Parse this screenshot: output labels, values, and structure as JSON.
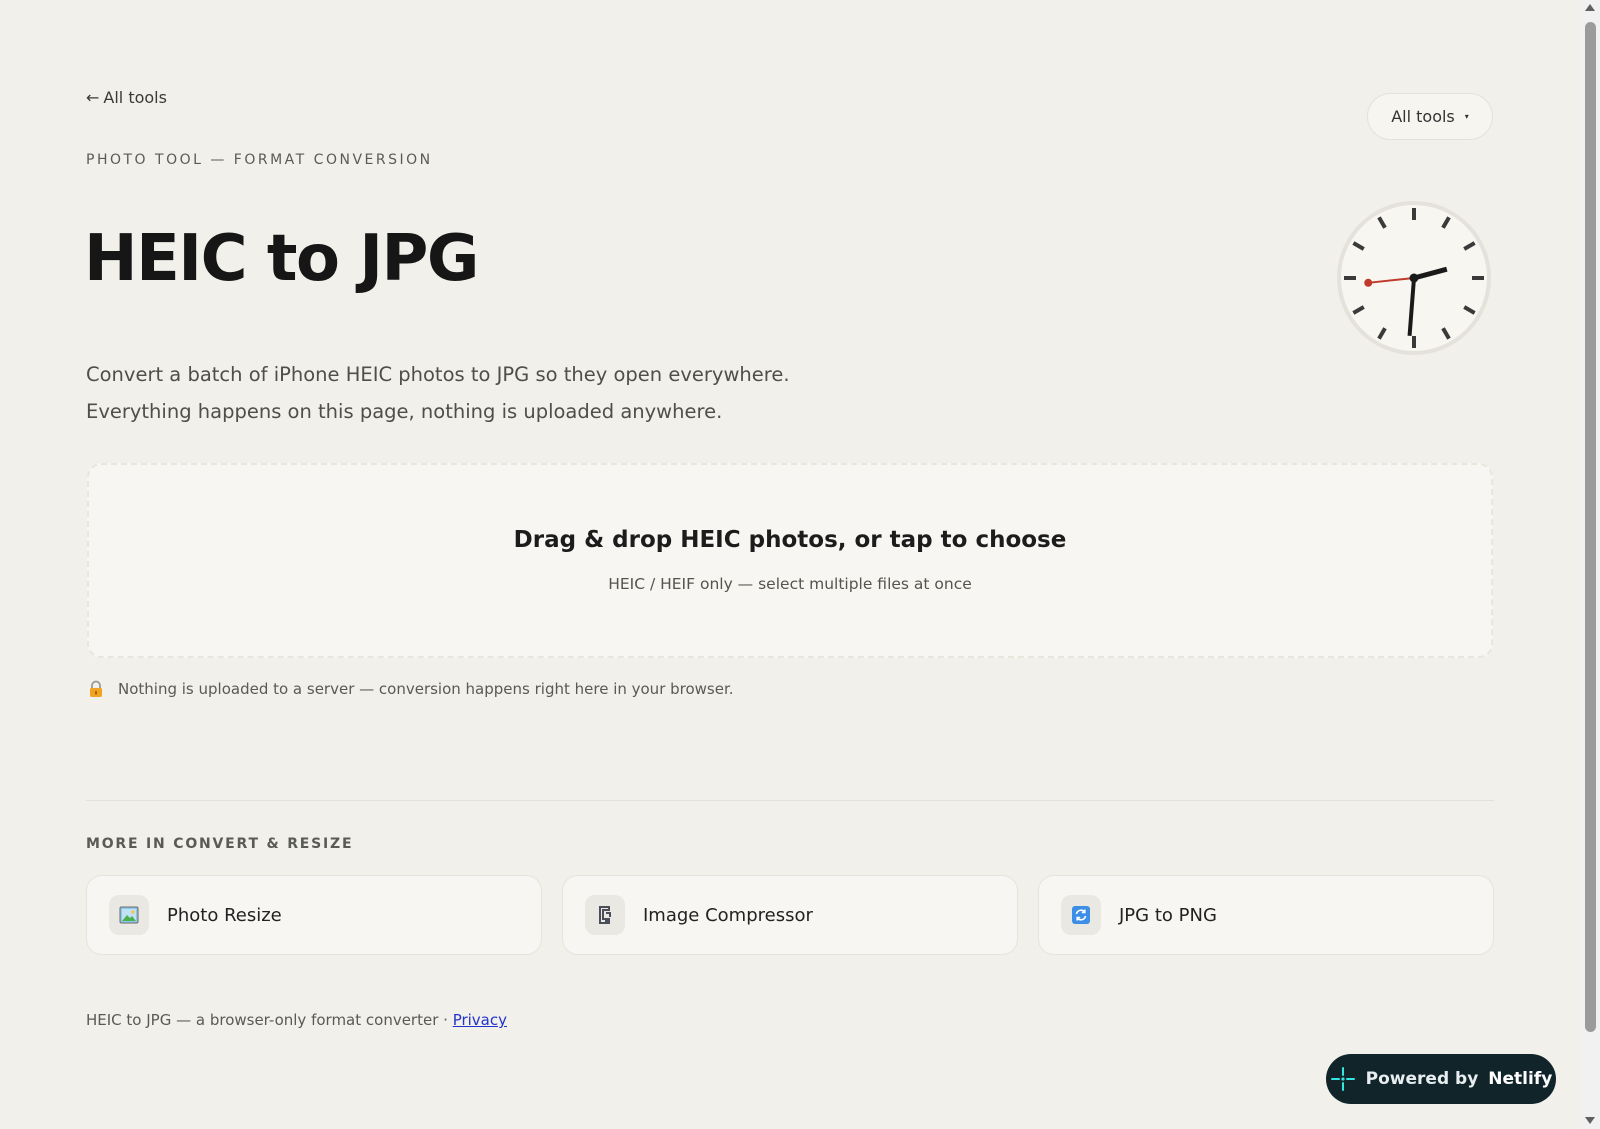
{
  "nav": {
    "back_arrow": "←",
    "back_label": "All tools",
    "all_tools_button": "All tools",
    "all_tools_caret": "▾"
  },
  "hero": {
    "eyebrow": "PHOTO TOOL — FORMAT CONVERSION",
    "title": "HEIC to JPG",
    "description_lines": [
      "Convert a batch of iPhone HEIC photos to JPG so they open everywhere.",
      "Everything happens on this page, nothing is uploaded anywhere."
    ]
  },
  "clock": {
    "hour": 2,
    "minute": 30,
    "second": 44,
    "second_hand_color": "#c0392b"
  },
  "dropzone": {
    "title": "Drag & drop HEIC photos, or tap to choose",
    "subtitle": "HEIC / HEIF only — select multiple files at once"
  },
  "privacy_note": {
    "icon": "lock-icon",
    "text": "Nothing is uploaded to a server — conversion happens right here in your browser."
  },
  "related": {
    "section_label": "MORE IN CONVERT & RESIZE",
    "cards": [
      {
        "label": "Photo Resize",
        "icon": "picture-icon"
      },
      {
        "label": "Image Compressor",
        "icon": "clamp-icon"
      },
      {
        "label": "JPG to PNG",
        "icon": "convert-icon"
      }
    ]
  },
  "footer": {
    "text": "HEIC to JPG — a browser-only format converter · ",
    "privacy_link": "Privacy"
  },
  "badge": {
    "powered": "Powered by",
    "brand": "Netlify",
    "brand_color": "#32e6e2"
  }
}
